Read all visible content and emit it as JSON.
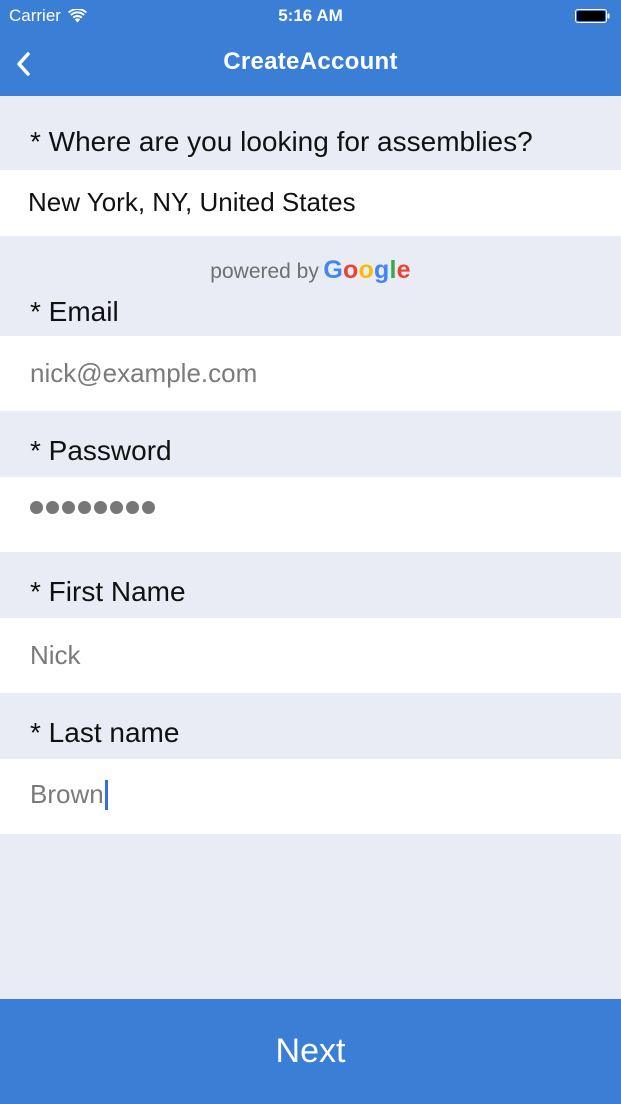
{
  "status_bar": {
    "carrier": "Carrier",
    "time": "5:16 AM"
  },
  "nav": {
    "title": "CreateAccount",
    "back_icon": "chevron-left-icon"
  },
  "colors": {
    "accent": "#3a7fd5",
    "background": "#e9ecf4",
    "field_background": "#ffffff",
    "caret": "#2f6fe0"
  },
  "form": {
    "location": {
      "label": "* Where are you looking for assemblies?",
      "value": "New York, NY, United States",
      "attribution": "powered by",
      "attribution_brand": [
        "G",
        "o",
        "o",
        "g",
        "l",
        "e"
      ],
      "attribution_brand_colors": [
        "#4285F4",
        "#EA4335",
        "#FBBC05",
        "#4285F4",
        "#34A853",
        "#EA4335"
      ]
    },
    "email": {
      "label": "* Email",
      "value": "nick@example.com"
    },
    "password": {
      "label": "* Password",
      "masked_length": 8
    },
    "first_name": {
      "label": "* First Name",
      "value": "Nick"
    },
    "last_name": {
      "label": "* Last name",
      "value": "Brown"
    }
  },
  "next_button": {
    "label": "Next"
  }
}
